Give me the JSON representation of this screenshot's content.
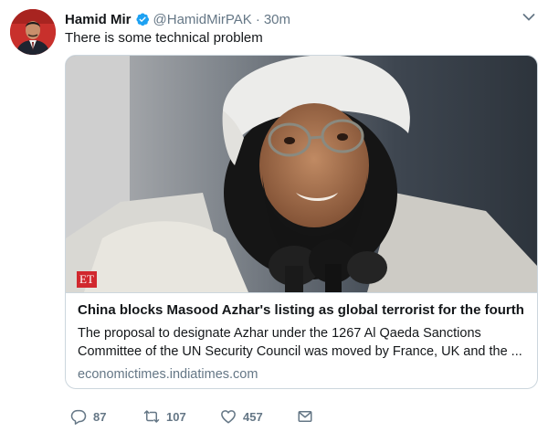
{
  "author": {
    "name": "Hamid Mir",
    "handle": "@HamidMirPAK",
    "separator": "·",
    "time": "30m",
    "verified": true
  },
  "tweet": {
    "text": "There is some technical problem"
  },
  "card": {
    "image_badge": "ET",
    "title": "China blocks Masood Azhar's listing as global terrorist for the fourth ...",
    "description": "The proposal to designate Azhar under the 1267 Al Qaeda Sanctions Committee of the UN Security Council was moved by France, UK and the ...",
    "domain": "economictimes.indiatimes.com"
  },
  "actions": {
    "reply_count": "87",
    "retweet_count": "107",
    "like_count": "457"
  },
  "colors": {
    "text": "#14171a",
    "muted": "#657786",
    "border": "#ccd6dd",
    "verified": "#1da1f2",
    "et_red": "#d1282e"
  },
  "icons": {
    "verified": "verified-badge-icon",
    "caret": "chevron-down-icon",
    "reply": "reply-icon",
    "retweet": "retweet-icon",
    "like": "heart-icon",
    "dm": "envelope-icon"
  }
}
